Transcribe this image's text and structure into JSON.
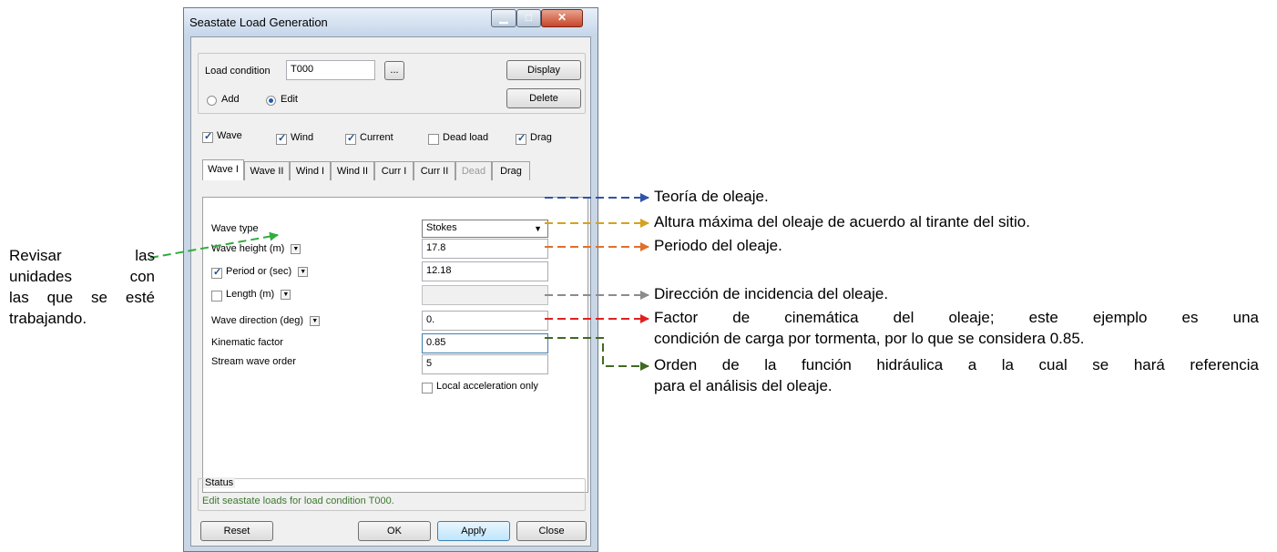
{
  "window": {
    "title": "Seastate Load Generation"
  },
  "load_condition": {
    "label": "Load condition",
    "value": "T000",
    "browse_label": "...",
    "display_label": "Display",
    "delete_label": "Delete",
    "add_label": "Add",
    "edit_label": "Edit",
    "mode": "Edit"
  },
  "options": {
    "wave": {
      "label": "Wave",
      "checked": true
    },
    "wind": {
      "label": "Wind",
      "checked": true
    },
    "current": {
      "label": "Current",
      "checked": true
    },
    "dead_load": {
      "label": "Dead load",
      "checked": false
    },
    "drag": {
      "label": "Drag",
      "checked": true
    }
  },
  "tabs": [
    {
      "label": "Wave I",
      "active": true
    },
    {
      "label": "Wave II"
    },
    {
      "label": "Wind I"
    },
    {
      "label": "Wind II"
    },
    {
      "label": "Curr I"
    },
    {
      "label": "Curr II"
    },
    {
      "label": "Dead",
      "disabled": true
    },
    {
      "label": "Drag"
    }
  ],
  "wave_form": {
    "wave_type": {
      "label": "Wave type",
      "value": "Stokes"
    },
    "wave_height": {
      "label": "Wave height",
      "unit": "(m)",
      "value": "17.8"
    },
    "period": {
      "label": "Period or",
      "unit": "(sec)",
      "value": "12.18",
      "checked": true
    },
    "length": {
      "label": "Length",
      "unit": "(m)",
      "value": "",
      "checked": false
    },
    "wave_direction": {
      "label": "Wave direction (deg)",
      "value": "0."
    },
    "kinematic_factor": {
      "label": "Kinematic factor",
      "value": "0.85"
    },
    "stream_wave_order": {
      "label": "Stream wave order",
      "value": "5"
    },
    "local_acceleration": {
      "label": "Local acceleration only",
      "checked": false
    }
  },
  "status": {
    "label": "Status",
    "text": "Edit seastate loads for load condition T000."
  },
  "footer": {
    "reset_label": "Reset",
    "ok_label": "OK",
    "apply_label": "Apply",
    "close_label": "Close"
  },
  "annotations": {
    "left_note": [
      "Revisar las",
      "unidades con",
      "las que se esté",
      "trabajando."
    ],
    "wave_type": "Teoría de oleaje.",
    "wave_height": "Altura máxima del oleaje de acuerdo al tirante del sitio.",
    "period": "Periodo del oleaje.",
    "direction": "Dirección de incidencia del oleaje.",
    "kinematic_line1": "Factor de cinemática del oleaje; este ejemplo es una",
    "kinematic_line2": "condición de carga por tormenta, por lo que se considera 0.85.",
    "order_line1": "Orden de la función hidráulica a la cual se hará referencia",
    "order_line2": "para el análisis del oleaje."
  },
  "colors": {
    "blue": "#2f55a4",
    "gold": "#d6a21e",
    "orange": "#e0702a",
    "gray": "#8c8c8c",
    "red": "#e02020",
    "green_dark": "#3f6a22",
    "green": "#2fae3c",
    "status_text": "#3b7a2c"
  }
}
